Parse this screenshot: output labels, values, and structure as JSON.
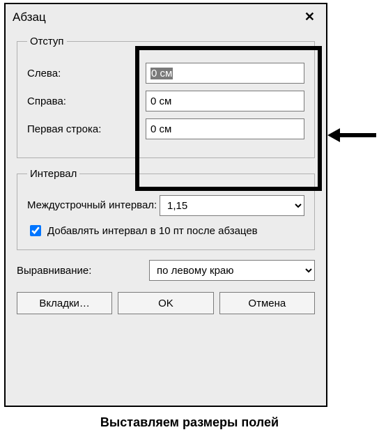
{
  "dialog": {
    "title": "Абзац",
    "close_label": "✕"
  },
  "indent": {
    "legend": "Отступ",
    "left_label": "Слева:",
    "left_value": "0 см",
    "right_label": "Справа:",
    "right_value": "0 см",
    "first_line_label": "Первая строка:",
    "first_line_value": "0 см"
  },
  "spacing": {
    "legend": "Интервал",
    "line_spacing_label": "Междустрочный интервал:",
    "line_spacing_value": "1,15",
    "add_space_checked": true,
    "add_space_label": "Добавлять интервал в 10 пт после абзацев"
  },
  "alignment": {
    "label": "Выравнивание:",
    "value": "по левому краю"
  },
  "buttons": {
    "tabs": "Вкладки…",
    "ok": "OK",
    "cancel": "Отмена"
  },
  "caption": "Выставляем размеры полей"
}
